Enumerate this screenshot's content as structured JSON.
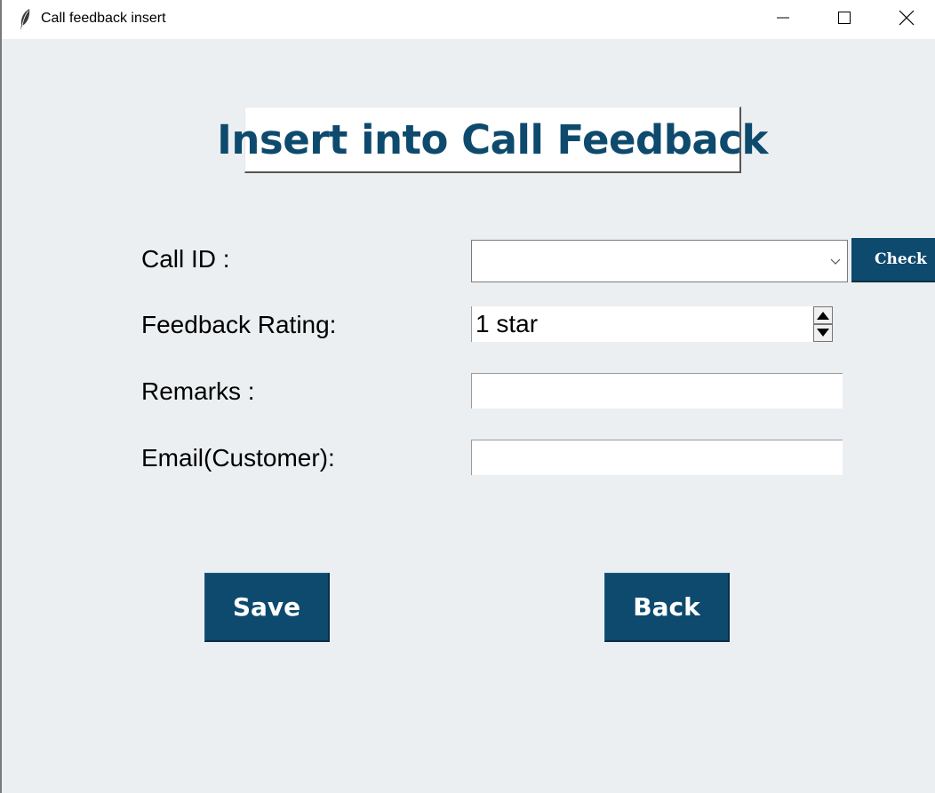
{
  "window": {
    "title": "Call feedback insert",
    "icon": "feather-icon",
    "controls": [
      "minimize-icon",
      "maximize-icon",
      "close-icon"
    ]
  },
  "heading": "Insert into Call Feedback",
  "form": {
    "call_id": {
      "label": "Call ID :",
      "value": "",
      "check_button": "Check"
    },
    "feedback_rating": {
      "label": "Feedback Rating:",
      "value": "1 star"
    },
    "remarks": {
      "label": "Remarks :",
      "value": ""
    },
    "email": {
      "label": "Email(Customer):",
      "value": ""
    }
  },
  "actions": {
    "save": "Save",
    "back": "Back"
  },
  "colors": {
    "accent": "#0d4a6e",
    "background": "#eceff1",
    "button_text": "#ffffff"
  }
}
